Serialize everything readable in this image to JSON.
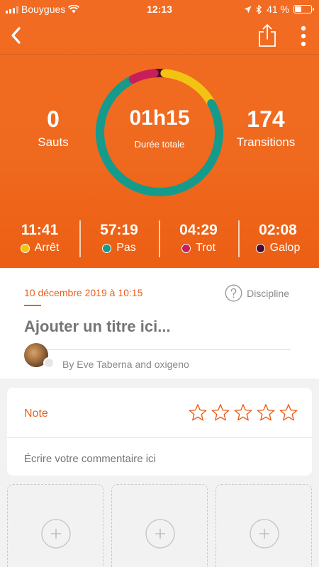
{
  "status_bar": {
    "carrier": "Bouygues",
    "time": "12:13",
    "battery": "41 %",
    "battery_level": 0.41
  },
  "nav": {
    "back_icon": "chevron-left-icon",
    "share_icon": "share-icon",
    "more_icon": "more-vertical-icon"
  },
  "summary": {
    "jumps": {
      "value": "0",
      "label": "Sauts"
    },
    "duration": {
      "value": "01h15",
      "label": "Durée totale"
    },
    "transitions": {
      "value": "174",
      "label": "Transitions"
    }
  },
  "gaits": [
    {
      "time": "11:41",
      "label": "Arrêt",
      "color": "#f2c411",
      "minutes": 11.68
    },
    {
      "time": "57:19",
      "label": "Pas",
      "color": "#159a8c",
      "minutes": 57.32
    },
    {
      "time": "04:29",
      "label": "Trot",
      "color": "#c81e5c",
      "minutes": 4.48
    },
    {
      "time": "02:08",
      "label": "Galop",
      "color": "#4a0a2c",
      "minutes": 2.13
    }
  ],
  "session": {
    "date": "10 décembre 2019 à 10:15",
    "discipline": "Discipline",
    "title_placeholder": "Ajouter un titre ici...",
    "byline": "By Eve Taberna and oxigeno"
  },
  "note": {
    "label": "Note",
    "rating": 0,
    "max": 5,
    "comment_placeholder": "Écrire votre commentaire ici"
  },
  "photos": {
    "slots": 3,
    "add_icon": "plus-circle-icon"
  },
  "colors": {
    "accent": "#ef6a1f",
    "text_accent": "#e8611c"
  }
}
